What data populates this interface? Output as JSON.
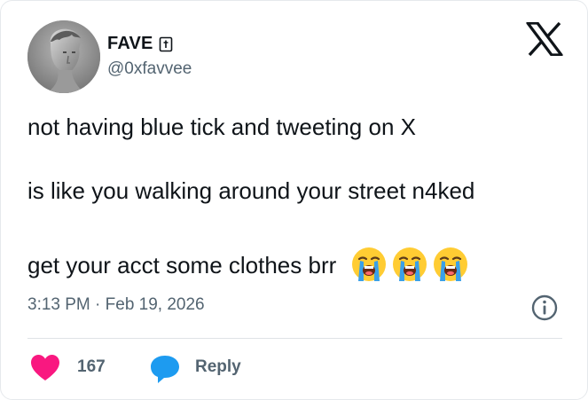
{
  "user": {
    "display_name": "FAVE",
    "handle": "@0xfavvee",
    "avatar_icon": "statue-head-avatar",
    "name_badge_icon": "card-badge-icon"
  },
  "brand": {
    "logo": "x-logo-icon"
  },
  "tweet": {
    "line1": "not having blue tick and tweeting on X",
    "line2": "is like you walking around your street n4ked",
    "line3": "get your acct some clothes brr",
    "emojis": [
      "loudly-crying-face",
      "loudly-crying-face",
      "loudly-crying-face"
    ],
    "timestamp": "3:13 PM · Feb 19, 2026"
  },
  "actions": {
    "like_count": "167",
    "reply_label": "Reply",
    "like_color": "#f91880",
    "reply_color": "#1d9bf0"
  },
  "colors": {
    "text": "#0f1419",
    "secondary": "#536471",
    "divider": "#dfe3e6"
  }
}
